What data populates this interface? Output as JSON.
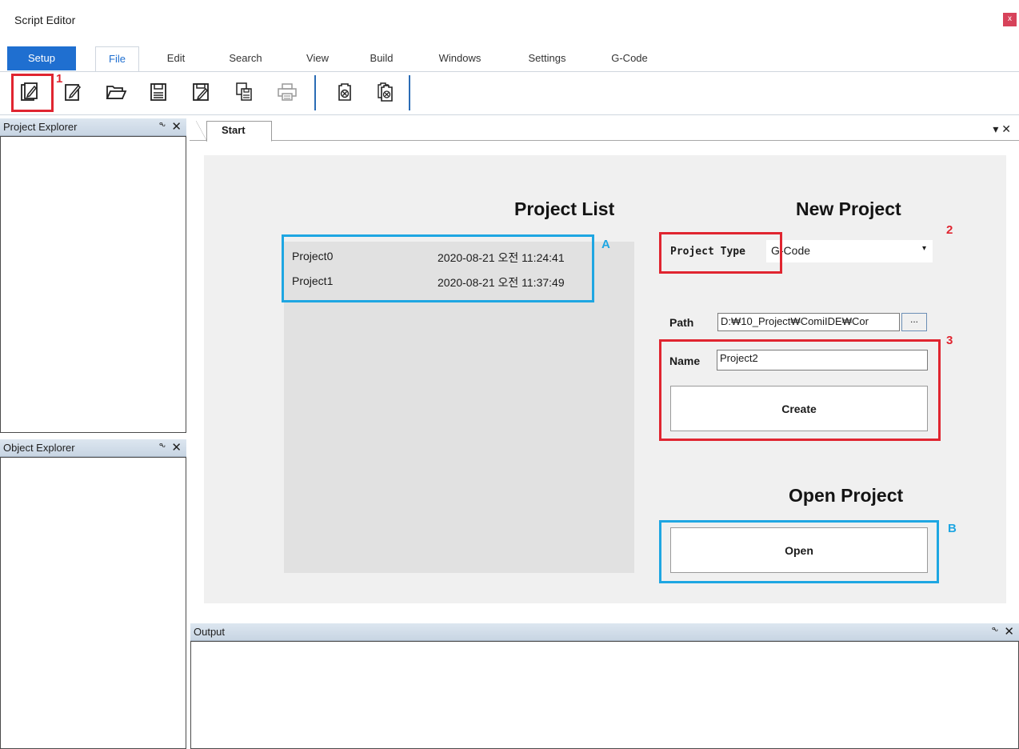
{
  "window": {
    "title": "Script Editor",
    "close_label": "x"
  },
  "ribbon": {
    "tabs": [
      {
        "label": "Setup"
      },
      {
        "label": "File"
      },
      {
        "label": "Edit"
      },
      {
        "label": "Search"
      },
      {
        "label": "View"
      },
      {
        "label": "Build"
      },
      {
        "label": "Windows"
      },
      {
        "label": "Settings"
      },
      {
        "label": "G-Code"
      }
    ],
    "active_tab": "File"
  },
  "toolbar": {
    "icons": [
      "new-project-icon",
      "new-file-icon",
      "open-folder-icon",
      "save-icon",
      "save-as-icon",
      "save-all-icon",
      "print-icon",
      "close-file-icon",
      "close-all-icon"
    ]
  },
  "annotations": {
    "one": "1",
    "two": "2",
    "three": "3",
    "a": "A",
    "b": "B"
  },
  "panels": {
    "project_explorer": {
      "title": "Project Explorer",
      "pin": "ᖕ",
      "close": "✕"
    },
    "object_explorer": {
      "title": "Object Explorer",
      "pin": "ᖕ",
      "close": "✕"
    },
    "output": {
      "title": "Output",
      "pin": "ᖕ",
      "close": "✕"
    }
  },
  "document": {
    "tab_label": "Start",
    "controls": "▾ ✕"
  },
  "start": {
    "project_list_title": "Project List",
    "projects": [
      {
        "name": "Project0",
        "date": "2020-08-21 오전 11:24:41"
      },
      {
        "name": "Project1",
        "date": "2020-08-21 오전 11:37:49"
      }
    ],
    "new_project_title": "New Project",
    "project_type_label": "Project Type",
    "project_type_value": "G-Code",
    "path_label": "Path",
    "path_value": "D:₩10_Project₩ComiIDE₩Cor",
    "browse_label": "...",
    "name_label": "Name",
    "name_value": "Project2",
    "create_label": "Create",
    "open_project_title": "Open Project",
    "open_label": "Open"
  },
  "colors": {
    "accent": "#1f6fd0",
    "annotation_red": "#e02530",
    "annotation_blue": "#1ea6e2"
  }
}
